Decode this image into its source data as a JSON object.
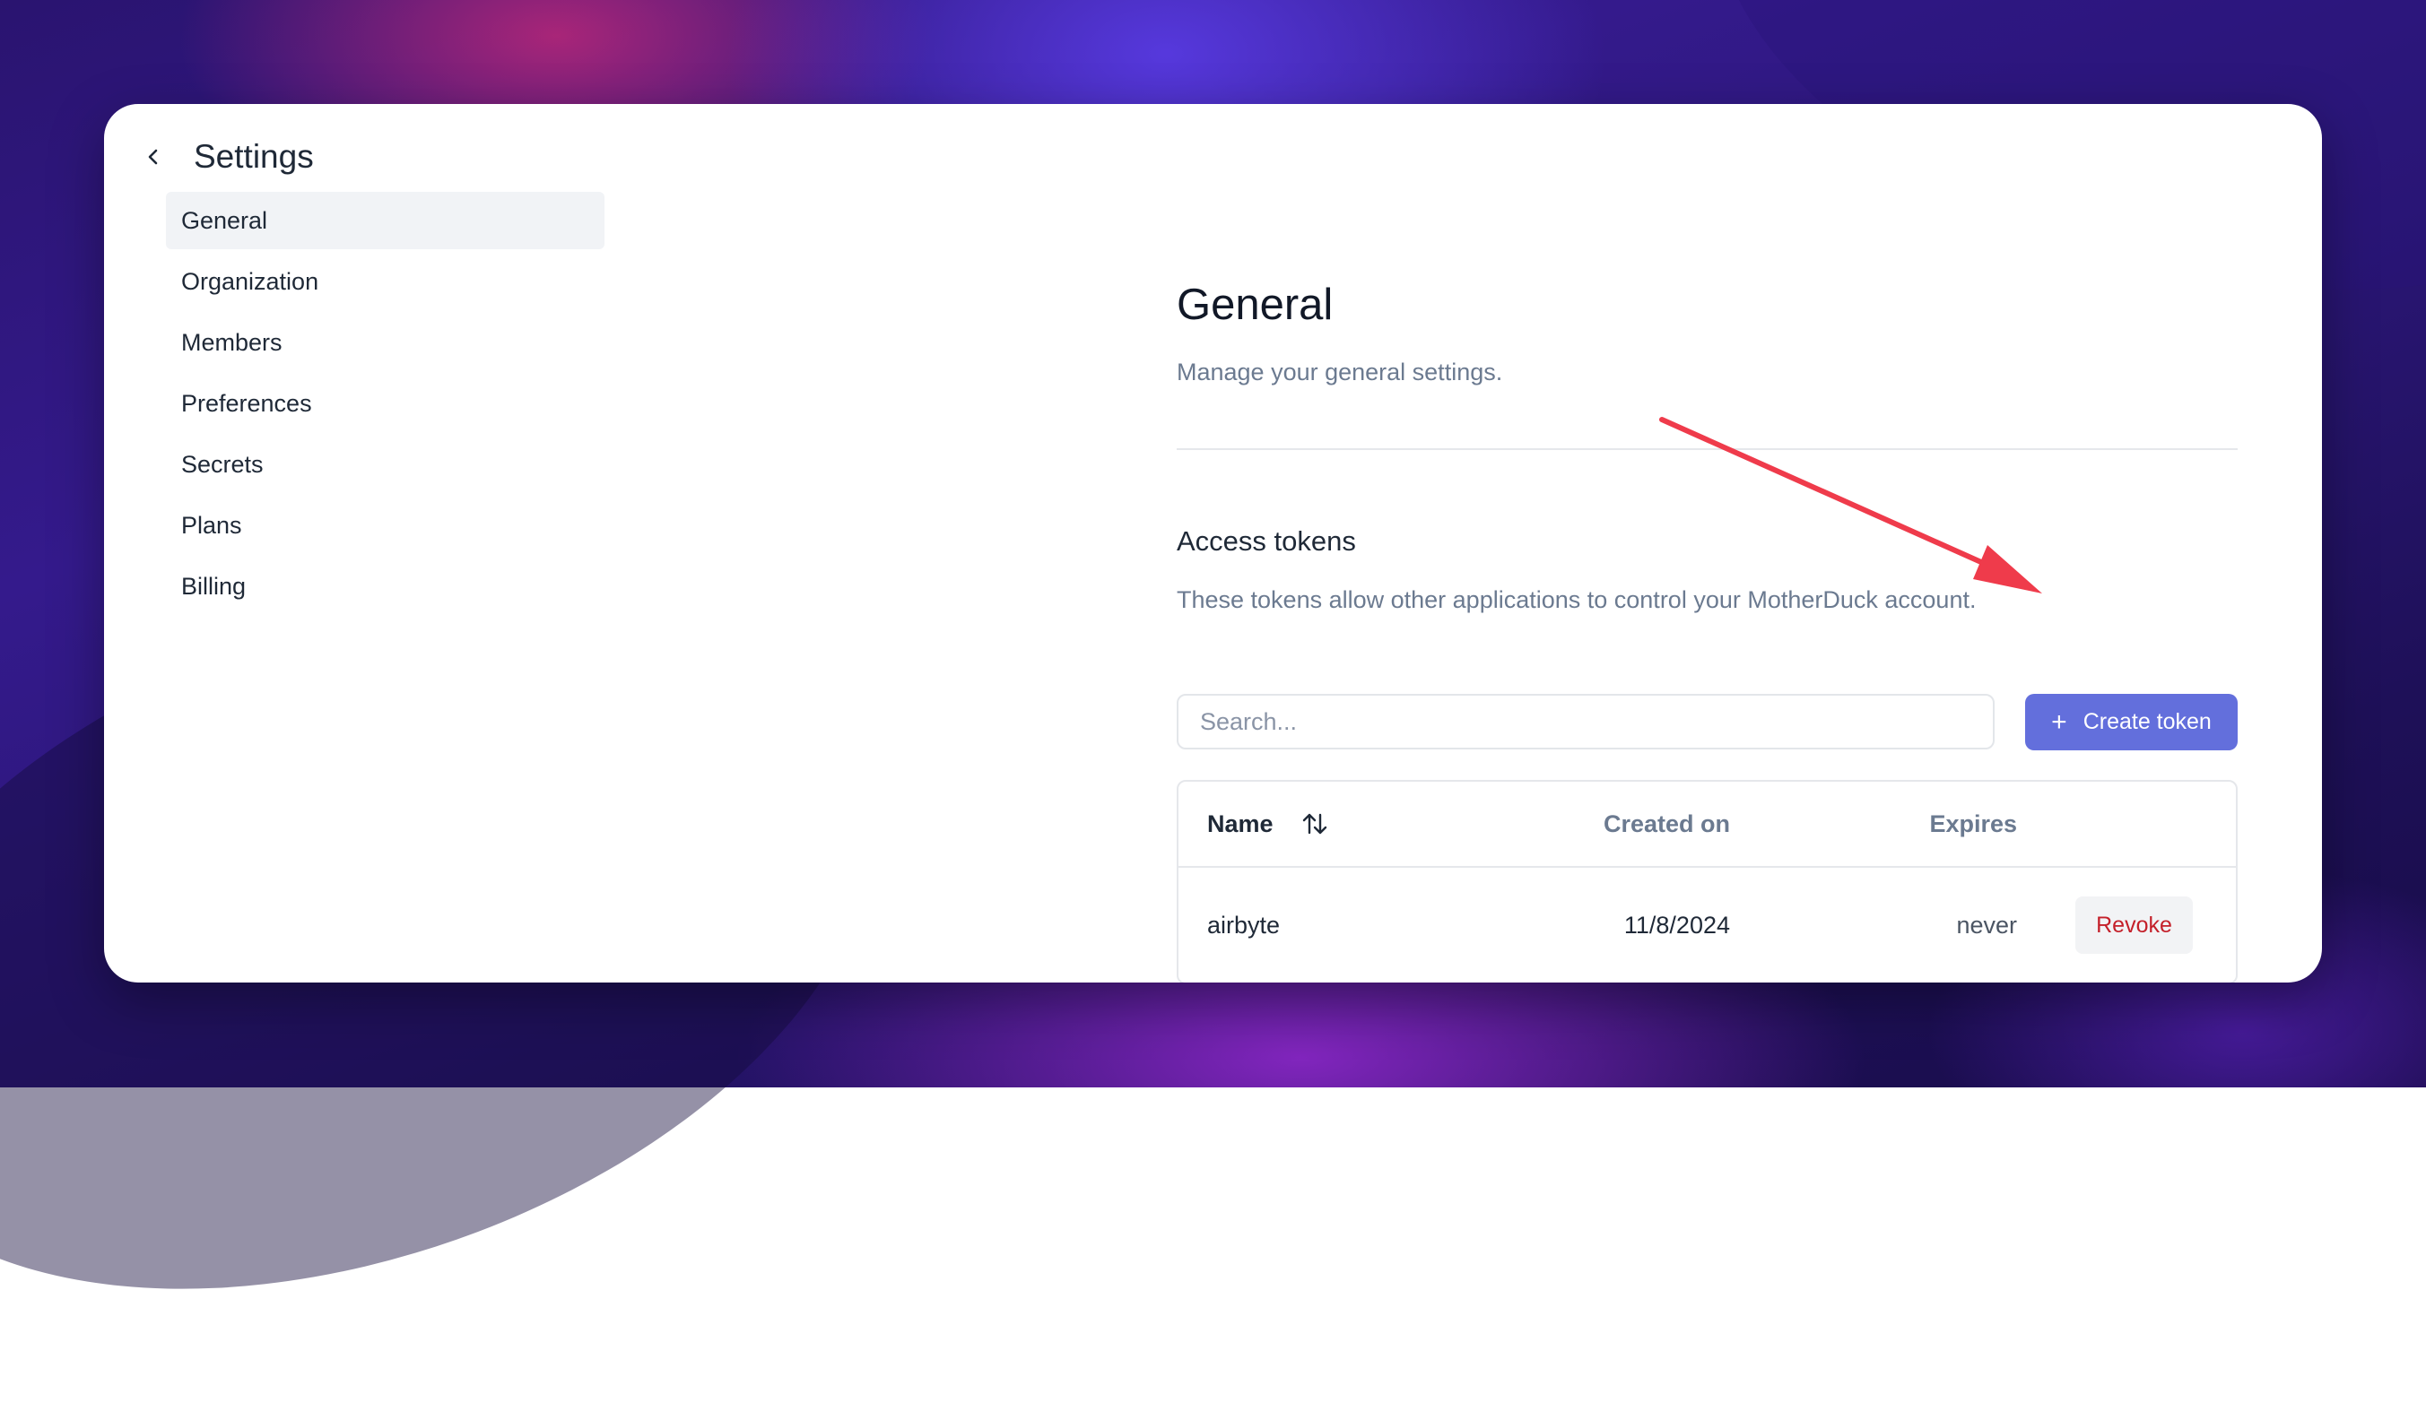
{
  "window": {
    "title": "Settings"
  },
  "sidebar": {
    "items": [
      {
        "label": "General",
        "active": true
      },
      {
        "label": "Organization",
        "active": false
      },
      {
        "label": "Members",
        "active": false
      },
      {
        "label": "Preferences",
        "active": false
      },
      {
        "label": "Secrets",
        "active": false
      },
      {
        "label": "Plans",
        "active": false
      },
      {
        "label": "Billing",
        "active": false
      }
    ]
  },
  "main": {
    "heading": "General",
    "subheading": "Manage your general settings.",
    "tokens": {
      "heading": "Access tokens",
      "description": "These tokens allow other applications to control your MotherDuck account.",
      "search_placeholder": "Search...",
      "create_label": "Create token",
      "table": {
        "columns": [
          "Name",
          "Created on",
          "Expires"
        ],
        "rows": [
          {
            "name": "airbyte",
            "created": "11/8/2024",
            "expires": "never",
            "action": "Revoke"
          }
        ]
      }
    }
  },
  "icons": {
    "back": "chevron-left-icon",
    "sort": "sort-arrows-icon",
    "plus": "plus-icon"
  },
  "colors": {
    "primary": "#636fdc",
    "danger": "#c4202a",
    "annotation": "#ef3b4b",
    "muted_text": "#6b7a90"
  }
}
